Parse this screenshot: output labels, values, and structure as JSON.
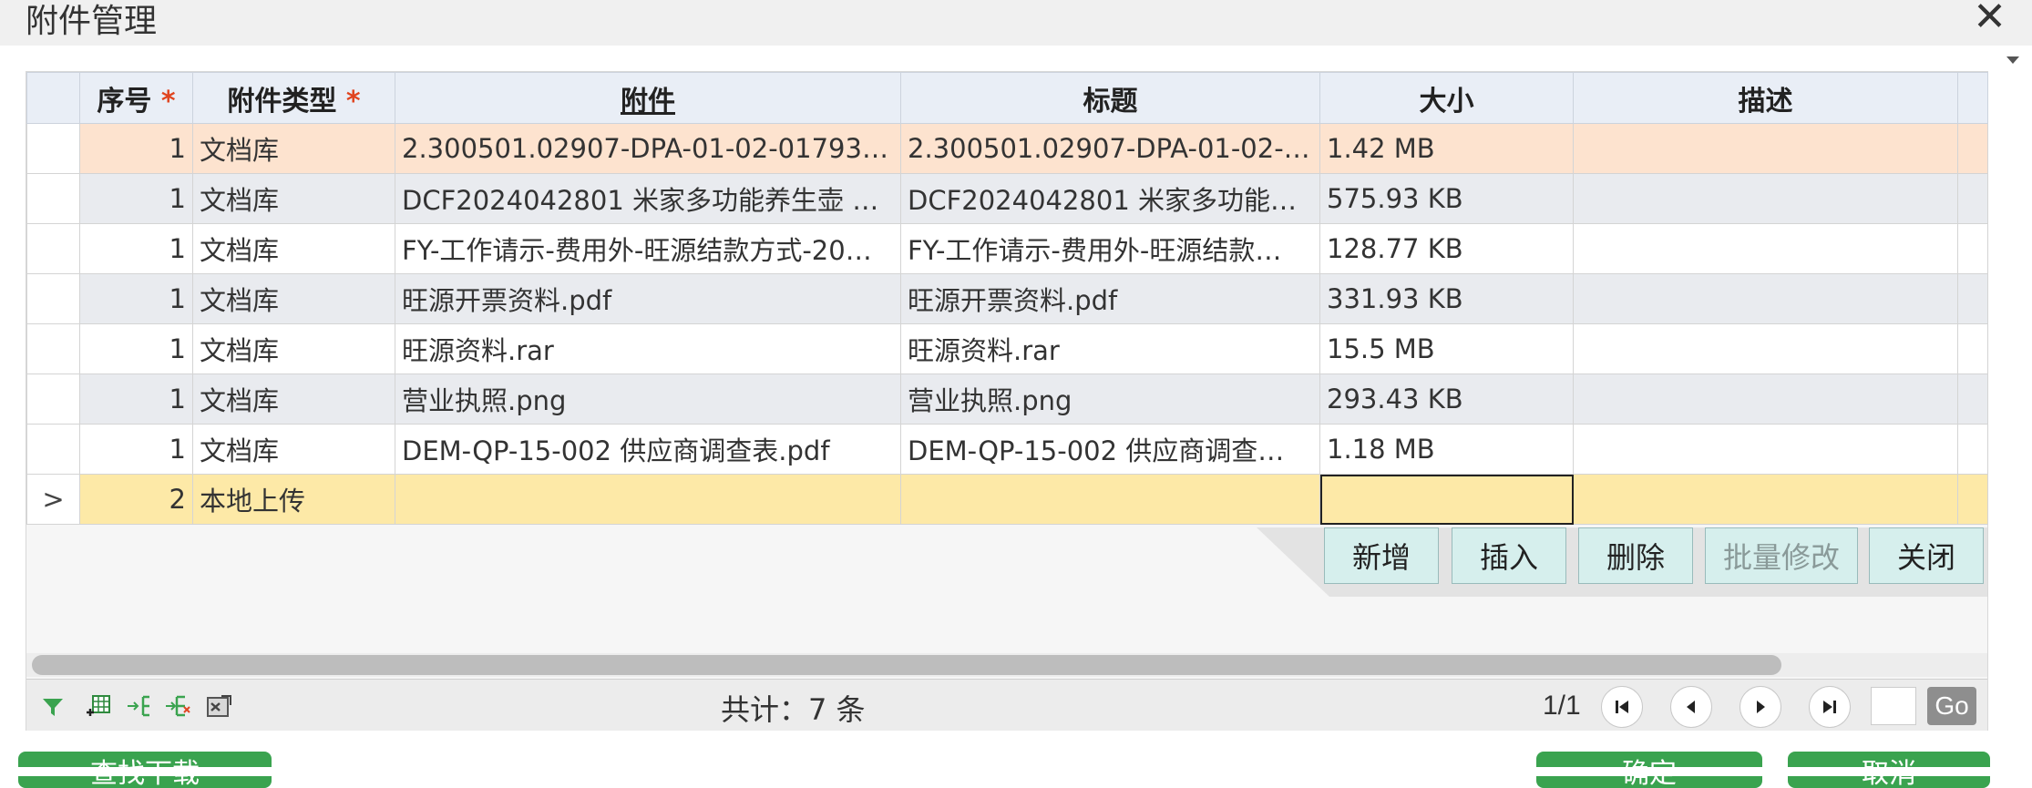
{
  "dialog": {
    "title": "附件管理"
  },
  "table": {
    "columns": {
      "index": "序号",
      "type": "附件类型",
      "attachment": "附件",
      "title": "标题",
      "size": "大小",
      "desc": "描述",
      "required_mark": "*"
    },
    "rows": [
      {
        "indicator": "",
        "index": "1",
        "type": "文档库",
        "attachment": "2.300501.02907-DPA-01-02-017932-…",
        "title": "2.300501.02907-DPA-01-02-0…",
        "size": "1.42 MB",
        "desc": ""
      },
      {
        "indicator": "",
        "index": "1",
        "type": "文档库",
        "attachment": "DCF2024042801 米家多功能养生壶 …",
        "title": "DCF2024042801 米家多功能养…",
        "size": "575.93 KB",
        "desc": ""
      },
      {
        "indicator": "",
        "index": "1",
        "type": "文档库",
        "attachment": "FY-工作请示-费用外-旺源结款方式-20…",
        "title": "FY-工作请示-费用外-旺源结款…",
        "size": "128.77 KB",
        "desc": ""
      },
      {
        "indicator": "",
        "index": "1",
        "type": "文档库",
        "attachment": "旺源开票资料.pdf",
        "title": "旺源开票资料.pdf",
        "size": "331.93 KB",
        "desc": ""
      },
      {
        "indicator": "",
        "index": "1",
        "type": "文档库",
        "attachment": "旺源资料.rar",
        "title": "旺源资料.rar",
        "size": "15.5 MB",
        "desc": ""
      },
      {
        "indicator": "",
        "index": "1",
        "type": "文档库",
        "attachment": "营业执照.png",
        "title": " 营业执照.png",
        "size": "293.43 KB",
        "desc": ""
      },
      {
        "indicator": "",
        "index": "1",
        "type": "文档库",
        "attachment": "DEM-QP-15-002  供应商调查表.pdf",
        "title": "DEM-QP-15-002  供应商调查…",
        "size": "1.18 MB",
        "desc": ""
      },
      {
        "indicator": ">",
        "index": "2",
        "type": "本地上传",
        "attachment": "",
        "title": "",
        "size": "",
        "desc": ""
      }
    ]
  },
  "actions": {
    "add": "新增",
    "insert": "插入",
    "delete": "删除",
    "batch_edit": "批量修改",
    "close": "关闭"
  },
  "footer": {
    "total": "共计：7 条",
    "page": "1/1",
    "go": "Go",
    "tool_icons": [
      "filter-icon",
      "grid-add-icon",
      "column-add-icon",
      "column-remove-icon",
      "export-icon"
    ]
  },
  "bottom_buttons": {
    "left": "查找下载",
    "confirm": "确定",
    "cancel": "取消"
  },
  "colors": {
    "selected_row": "#fde3cf",
    "new_row": "#fde9a7",
    "alt_row": "#e9ebef",
    "header_bg": "#e9eef6",
    "required": "#e0441f",
    "action_button": "#d6efed",
    "primary_green": "#3aa34f"
  }
}
